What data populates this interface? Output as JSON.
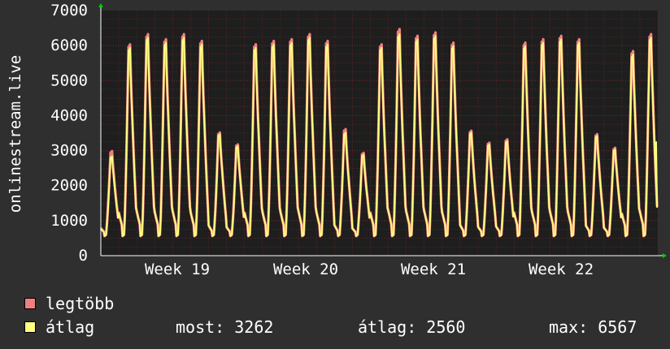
{
  "chart_data": {
    "type": "line",
    "ylabel": "onlinestream.live",
    "ylim": [
      0,
      7000
    ],
    "yticks": [
      0,
      1000,
      2000,
      3000,
      4000,
      5000,
      6000,
      7000
    ],
    "xticks": [
      "Week 19",
      "Week 20",
      "Week 21",
      "Week 22"
    ],
    "grid": true,
    "series": [
      {
        "name": "legtöbb",
        "color": "#f08080",
        "daily_peaks": [
          3050,
          6200,
          6500,
          6350,
          6500,
          6300,
          3600,
          3250,
          6200,
          6300,
          6350,
          6500,
          6300,
          3700,
          3000,
          6200,
          6650,
          6450,
          6550,
          6250,
          3650,
          3300,
          3400,
          6250,
          6350,
          6450,
          6350,
          3550,
          3150,
          6000,
          6500
        ]
      },
      {
        "name": "átlag",
        "color": "#ffff80",
        "daily_peaks": [
          2900,
          6100,
          6400,
          6250,
          6400,
          6200,
          3550,
          3200,
          6100,
          6200,
          6250,
          6400,
          6200,
          3600,
          2950,
          6100,
          6500,
          6350,
          6450,
          6150,
          3600,
          3250,
          3350,
          6150,
          6250,
          6350,
          6250,
          3500,
          3100,
          5900,
          6400
        ],
        "current": 3262
      }
    ]
  },
  "legend": {
    "max_label": "legtöbb",
    "avg_label": "átlag"
  },
  "stats": {
    "current": "most: 3262",
    "average": "átlag: 2560",
    "maximum": "max: 6567"
  },
  "colors": {
    "background": "#2f2f2f",
    "plot_background": "#1e1e1e",
    "grid": "#7a2a2a",
    "axis_arrow": "#00cc00",
    "text": "#ffffff"
  }
}
